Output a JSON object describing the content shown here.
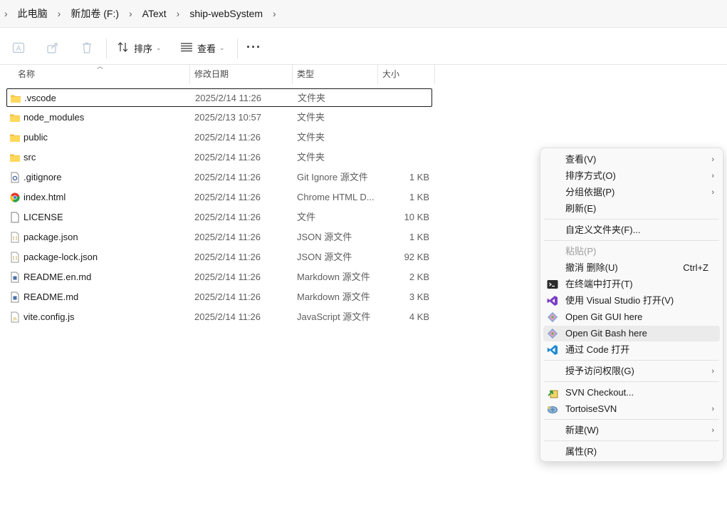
{
  "breadcrumb": {
    "items": [
      {
        "label": "此电脑"
      },
      {
        "label": "新加卷 (F:)"
      },
      {
        "label": "AText"
      },
      {
        "label": "ship-webSystem"
      }
    ]
  },
  "toolbar": {
    "sort_label": "排序",
    "view_label": "查看",
    "more_label": "···"
  },
  "columns": {
    "name": "名称",
    "date": "修改日期",
    "type": "类型",
    "size": "大小"
  },
  "files": [
    {
      "name": ".vscode",
      "date": "2025/2/14 11:26",
      "type": "文件夹",
      "size": "",
      "icon": "folder-icon"
    },
    {
      "name": "node_modules",
      "date": "2025/2/13 10:57",
      "type": "文件夹",
      "size": "",
      "icon": "folder-icon"
    },
    {
      "name": "public",
      "date": "2025/2/14 11:26",
      "type": "文件夹",
      "size": "",
      "icon": "folder-icon"
    },
    {
      "name": "src",
      "date": "2025/2/14 11:26",
      "type": "文件夹",
      "size": "",
      "icon": "folder-icon"
    },
    {
      "name": ".gitignore",
      "date": "2025/2/14 11:26",
      "type": "Git Ignore 源文件",
      "size": "1 KB",
      "icon": "gear-file-icon"
    },
    {
      "name": "index.html",
      "date": "2025/2/14 11:26",
      "type": "Chrome HTML D...",
      "size": "1 KB",
      "icon": "chrome-icon"
    },
    {
      "name": "LICENSE",
      "date": "2025/2/14 11:26",
      "type": "文件",
      "size": "10 KB",
      "icon": "file-icon"
    },
    {
      "name": "package.json",
      "date": "2025/2/14 11:26",
      "type": "JSON 源文件",
      "size": "1 KB",
      "icon": "json-file-icon"
    },
    {
      "name": "package-lock.json",
      "date": "2025/2/14 11:26",
      "type": "JSON 源文件",
      "size": "92 KB",
      "icon": "json-file-icon"
    },
    {
      "name": "README.en.md",
      "date": "2025/2/14 11:26",
      "type": "Markdown 源文件",
      "size": "2 KB",
      "icon": "markdown-file-icon"
    },
    {
      "name": "README.md",
      "date": "2025/2/14 11:26",
      "type": "Markdown 源文件",
      "size": "3 KB",
      "icon": "markdown-file-icon"
    },
    {
      "name": "vite.config.js",
      "date": "2025/2/14 11:26",
      "type": "JavaScript 源文件",
      "size": "4 KB",
      "icon": "js-file-icon"
    }
  ],
  "context_menu": {
    "view": "查看(V)",
    "sort_by": "排序方式(O)",
    "group_by": "分组依据(P)",
    "refresh": "刷新(E)",
    "customize_folder": "自定义文件夹(F)...",
    "paste": "粘贴(P)",
    "undo_delete": "撤消 删除(U)",
    "undo_shortcut": "Ctrl+Z",
    "open_in_terminal": "在终端中打开(T)",
    "open_visual_studio": "使用 Visual Studio 打开(V)",
    "git_gui": "Open Git GUI here",
    "git_bash": "Open Git Bash here",
    "open_code": "通过 Code 打开",
    "grant_access": "授予访问权限(G)",
    "svn_checkout": "SVN Checkout...",
    "tortoise_svn": "TortoiseSVN",
    "new": "新建(W)",
    "properties": "属性(R)"
  }
}
